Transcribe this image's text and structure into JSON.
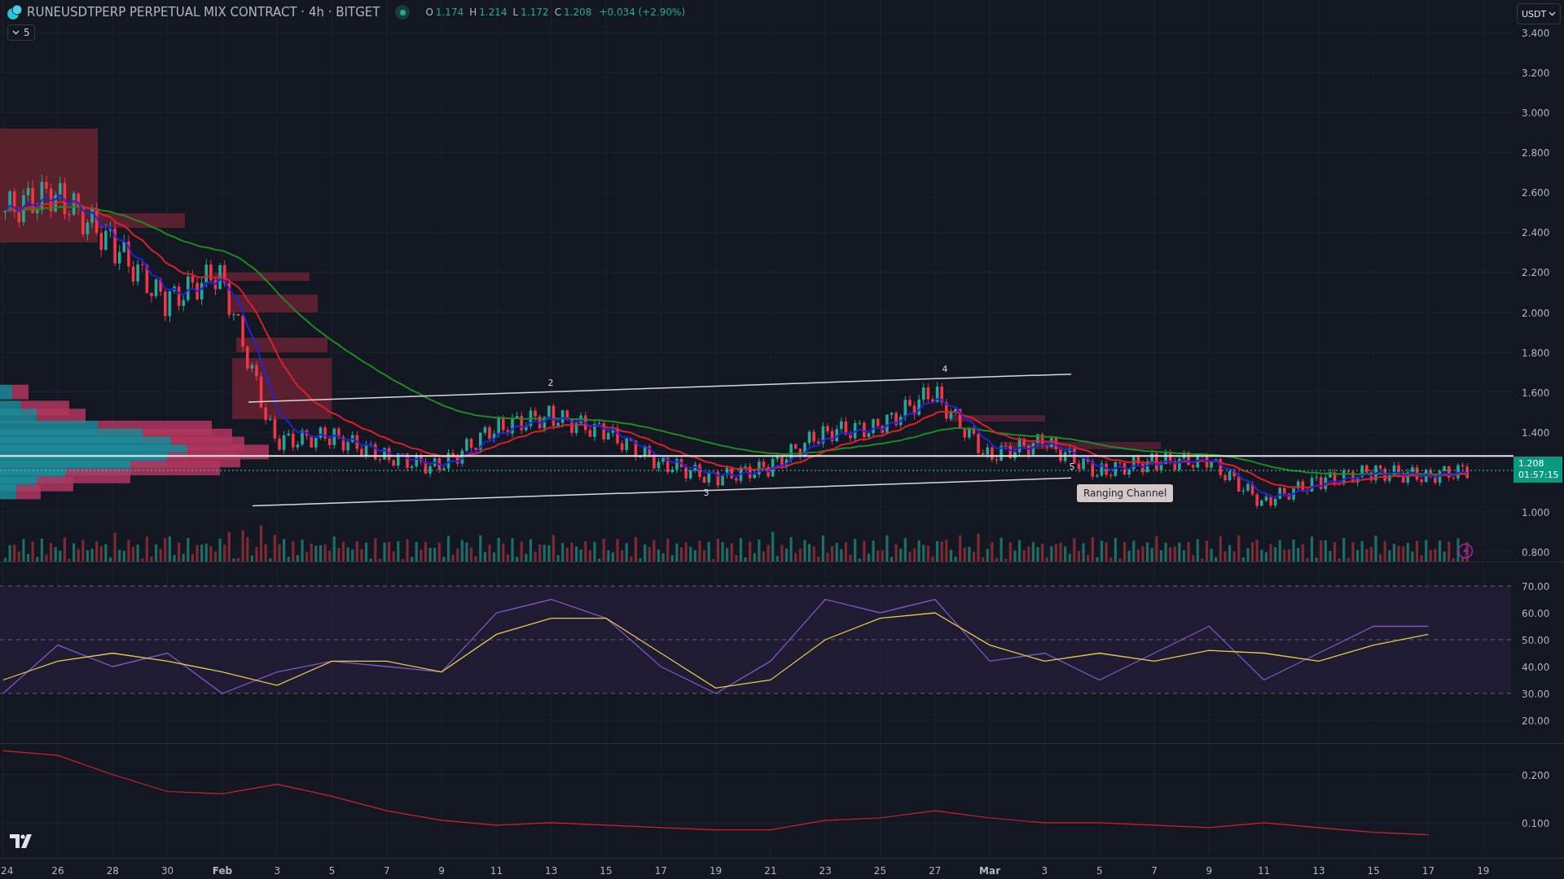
{
  "header": {
    "title": "RUNEUSDTPERP PERPETUAL MIX CONTRACT · 4h · BITGET",
    "ohlc": [
      {
        "label": "O",
        "value": "1.174"
      },
      {
        "label": "H",
        "value": "1.214"
      },
      {
        "label": "L",
        "value": "1.172"
      },
      {
        "label": "C",
        "value": "1.208"
      }
    ],
    "change": "+0.034 (+2.90%)"
  },
  "indicators_toggle": "5",
  "currency": "USDT",
  "price_tag": {
    "price": "1.208",
    "countdown": "01:57:15"
  },
  "wave_labels": [
    "2",
    "3",
    "4",
    "5"
  ],
  "channel_label": "Ranging Channel",
  "price_axis": [
    "3.400",
    "3.200",
    "3.000",
    "2.800",
    "2.600",
    "2.400",
    "2.200",
    "2.000",
    "1.800",
    "1.600",
    "1.400",
    "1.000",
    "0.800"
  ],
  "time_axis": [
    "24",
    "26",
    "28",
    "30",
    "Feb",
    "3",
    "5",
    "7",
    "9",
    "11",
    "13",
    "15",
    "17",
    "19",
    "21",
    "23",
    "25",
    "27",
    "Mar",
    "3",
    "5",
    "7",
    "9",
    "11",
    "13",
    "15",
    "17",
    "19"
  ],
  "rsi_pane": {
    "chart_data": {
      "type": "line",
      "grid": true,
      "ylim": [
        20,
        70
      ],
      "bands": [
        {
          "axis": "y",
          "from": 30,
          "to": 70,
          "color": "#1f1b33"
        }
      ],
      "series": [
        {
          "color": "#7e57c2",
          "values": [
            30,
            48,
            40,
            45,
            30,
            38,
            42,
            40,
            38,
            60,
            65,
            58,
            40,
            30,
            42,
            65,
            60,
            65,
            42,
            45,
            35,
            45,
            55,
            35,
            45,
            55,
            55,
            null
          ]
        },
        {
          "color": "#e6c94a",
          "values": [
            35,
            42,
            45,
            42,
            38,
            33,
            42,
            42,
            38,
            52,
            58,
            58,
            45,
            32,
            35,
            50,
            58,
            60,
            48,
            42,
            45,
            42,
            46,
            45,
            42,
            48,
            52,
            null
          ]
        }
      ],
      "yticks": [
        {
          "value": 70,
          "label": "70.00"
        },
        {
          "value": 60,
          "label": "60.00"
        },
        {
          "value": 50,
          "label": "50.00"
        },
        {
          "value": 40,
          "label": "40.00"
        },
        {
          "value": 30,
          "label": "30.00"
        },
        {
          "value": 20,
          "label": "20.00"
        }
      ]
    }
  },
  "lower_pane": {
    "chart_data": {
      "type": "line",
      "grid": true,
      "ylim": [
        0.027,
        0.264
      ],
      "series": [
        {
          "color": "#d0222e",
          "values": [
            0.25,
            0.24,
            0.2,
            0.165,
            0.16,
            0.18,
            0.155,
            0.125,
            0.105,
            0.095,
            0.1,
            0.095,
            0.09,
            0.085,
            0.085,
            0.105,
            0.11,
            0.125,
            0.11,
            0.1,
            0.1,
            0.095,
            0.09,
            0.1,
            0.09,
            0.08,
            0.075,
            null
          ]
        }
      ],
      "yticks": [
        {
          "value": 0.2,
          "label": "0.200"
        },
        {
          "value": 0.1,
          "label": "0.100"
        }
      ]
    }
  }
}
